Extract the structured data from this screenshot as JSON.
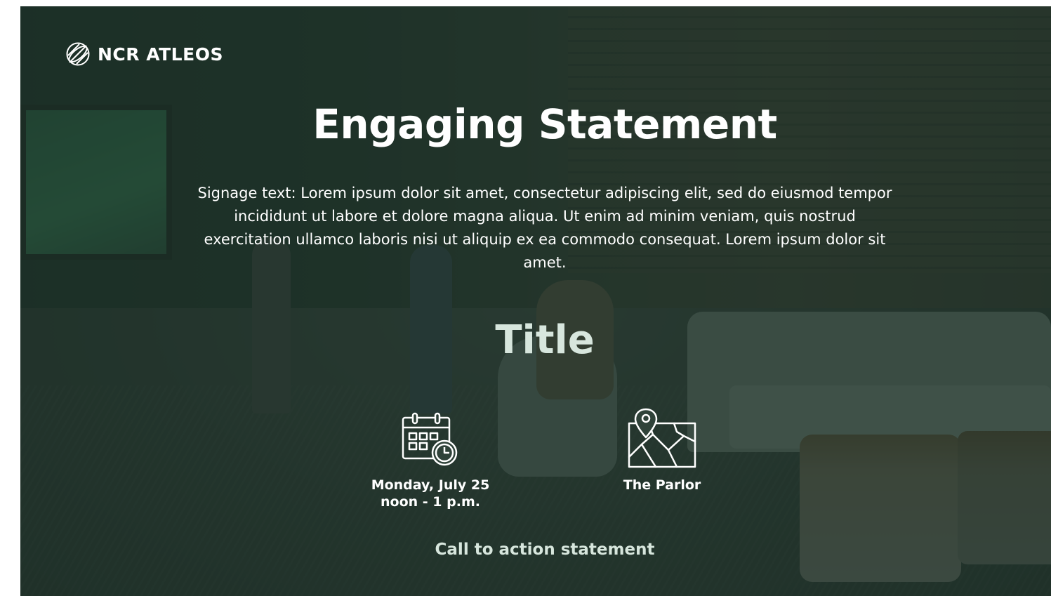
{
  "brand": {
    "logo_text": "NCR ATLEOS"
  },
  "headline": "Engaging Statement",
  "body_text": "Signage text: Lorem ipsum dolor sit amet, consectetur adipiscing elit, sed do eiusmod tempor incididunt ut labore et dolore magna aliqua. Ut enim ad minim veniam, quis nostrud exercitation ullamco laboris nisi ut aliquip ex ea commodo consequat. Lorem ipsum dolor sit amet.",
  "title": "Title",
  "event": {
    "date": "Monday, July 25",
    "time": "noon - 1 p.m.",
    "location": "The Parlor",
    "date_icon": "calendar-clock-icon",
    "location_icon": "map-pin-icon"
  },
  "cta": "Call to action statement",
  "colors": {
    "overlay": "#1c3228",
    "text": "#ffffff",
    "accent_text": "#d7e6dd"
  }
}
